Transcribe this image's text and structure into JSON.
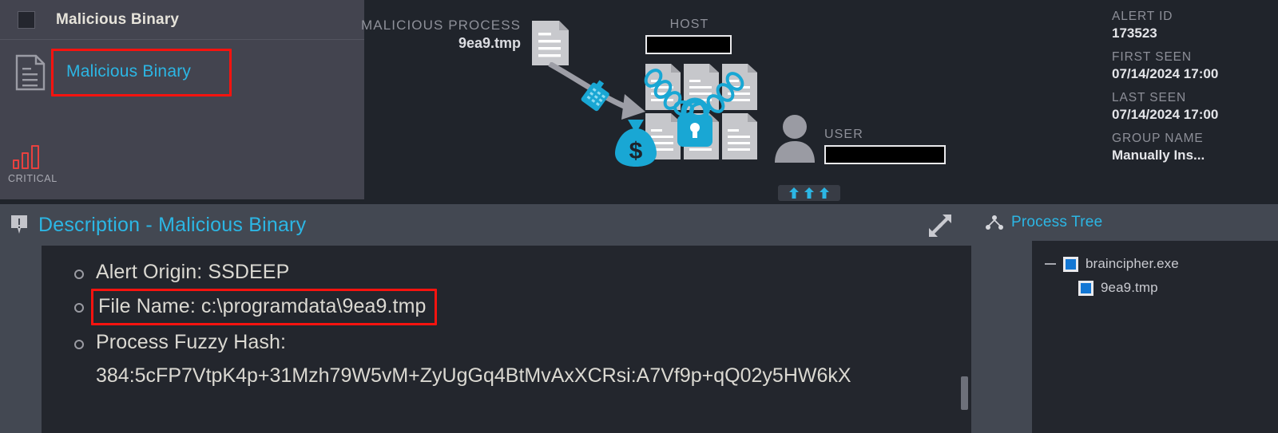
{
  "sidebar": {
    "header_title": "Malicious Binary",
    "checkbox_name": "select-all-checkbox",
    "item_label": "Malicious Binary",
    "severity_label": "CRITICAL",
    "severity_color": "#e8413f",
    "highlight_color": "#f8130f",
    "link_color": "#2cb6e4"
  },
  "graph": {
    "process": {
      "kicker": "MALICIOUS PROCESS",
      "value": "9ea9.tmp"
    },
    "host": {
      "kicker": "HOST",
      "value_redacted": true
    },
    "user": {
      "kicker": "USER",
      "value_redacted": true
    },
    "accent_color": "#19a7d4"
  },
  "meta": {
    "alert_id_label": "ALERT ID",
    "alert_id_value": "173523",
    "first_seen_label": "FIRST SEEN",
    "first_seen_value": "07/14/2024 17:00",
    "last_seen_label": "LAST SEEN",
    "last_seen_value": "07/14/2024 17:00",
    "group_name_label": "GROUP NAME",
    "group_name_value": "Manually Ins..."
  },
  "description": {
    "title": "Description - Malicious Binary",
    "bullets": [
      "Alert Origin: SSDEEP",
      "File Name: c:\\programdata\\9ea9.tmp",
      "Process Fuzzy Hash:"
    ],
    "highlighted_bullet_index": 1,
    "hash_value": "384:5cFP7VtpK4p+31Mzh79W5vM+ZyUgGq4BtMvAxXCRsi:A7Vf9p+qQ02y5HW6kX"
  },
  "process_tree": {
    "title": "Process Tree",
    "nodes": [
      {
        "label": "braincipher.exe",
        "depth": 0,
        "expanded": true
      },
      {
        "label": "9ea9.tmp",
        "depth": 1,
        "expanded": false
      }
    ]
  }
}
